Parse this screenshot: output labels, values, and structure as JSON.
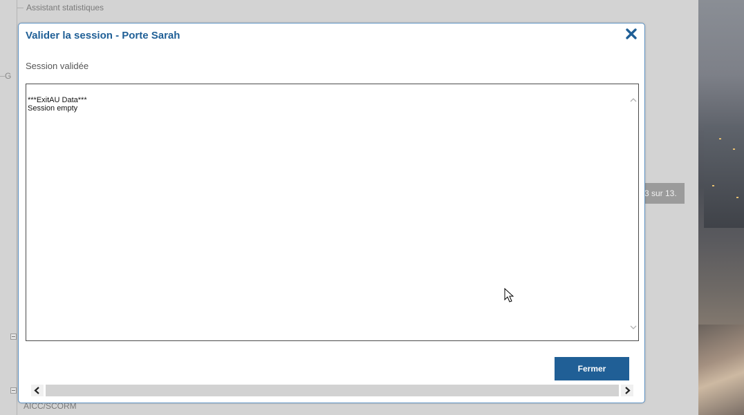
{
  "background": {
    "tree_items": [
      {
        "label": "Assistant statistiques"
      },
      {
        "label": "AICC/SCORM"
      }
    ],
    "left_label": "G",
    "page_counter": "3 sur 13."
  },
  "modal": {
    "title": "Valider la session - Porte Sarah",
    "subtitle": "Session validée",
    "content_lines": "***ExitAU Data***\nSession empty",
    "close_button_icon": "close-icon",
    "fermer_label": "Fermer"
  },
  "colors": {
    "title": "#1f5f96",
    "button": "#205f96",
    "modal_border": "#5a8fc0"
  }
}
